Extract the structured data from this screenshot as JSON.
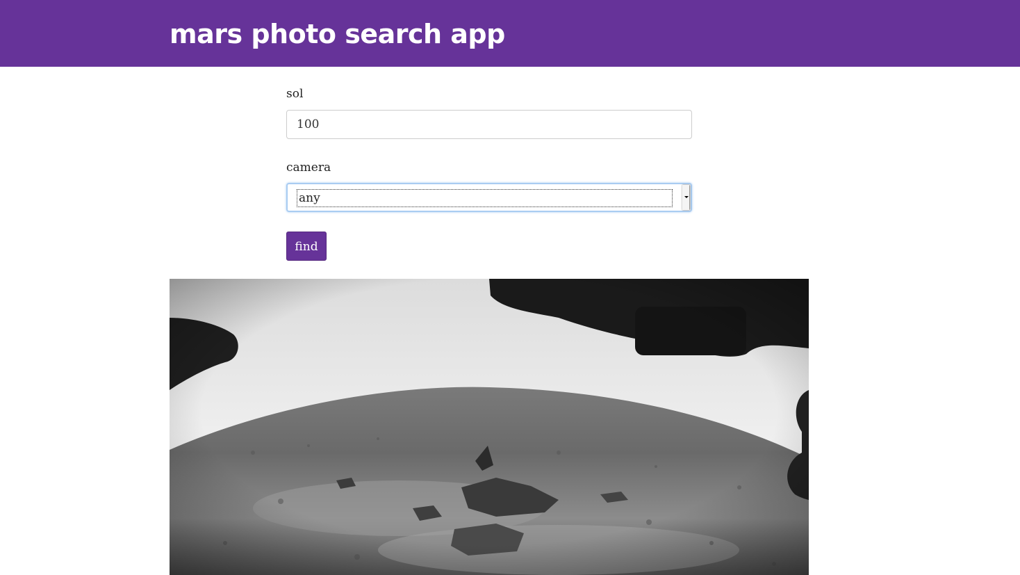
{
  "header": {
    "title": "mars photo search app"
  },
  "form": {
    "sol_label": "sol",
    "sol_value": "100",
    "camera_label": "camera",
    "camera_selected": "any",
    "find_label": "find"
  },
  "colors": {
    "brand": "#663399",
    "focus_ring": "#a9ccf2"
  },
  "results": {
    "photo_icon": "mars-surface-photo"
  }
}
